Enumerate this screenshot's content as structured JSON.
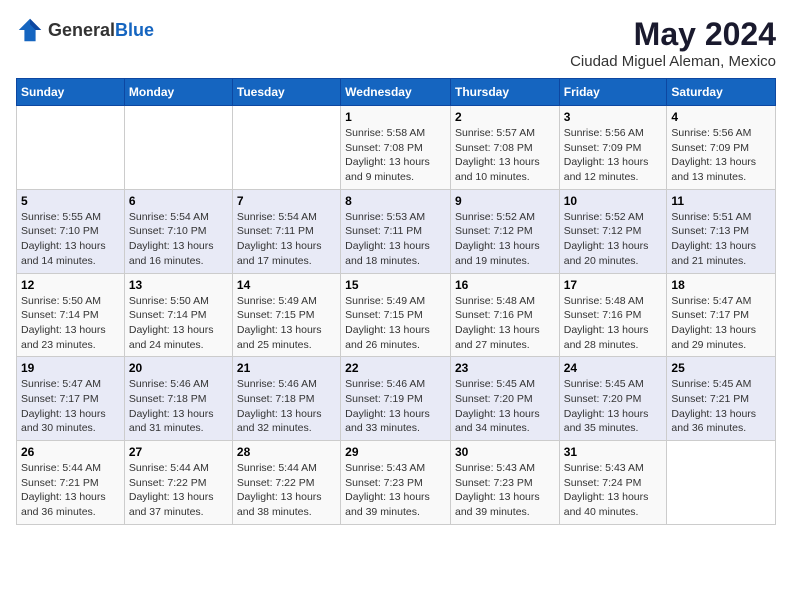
{
  "header": {
    "logo_general": "General",
    "logo_blue": "Blue",
    "main_title": "May 2024",
    "subtitle": "Ciudad Miguel Aleman, Mexico"
  },
  "days_of_week": [
    "Sunday",
    "Monday",
    "Tuesday",
    "Wednesday",
    "Thursday",
    "Friday",
    "Saturday"
  ],
  "weeks": [
    {
      "days": [
        {
          "num": "",
          "info": ""
        },
        {
          "num": "",
          "info": ""
        },
        {
          "num": "",
          "info": ""
        },
        {
          "num": "1",
          "info": "Sunrise: 5:58 AM\nSunset: 7:08 PM\nDaylight: 13 hours\nand 9 minutes."
        },
        {
          "num": "2",
          "info": "Sunrise: 5:57 AM\nSunset: 7:08 PM\nDaylight: 13 hours\nand 10 minutes."
        },
        {
          "num": "3",
          "info": "Sunrise: 5:56 AM\nSunset: 7:09 PM\nDaylight: 13 hours\nand 12 minutes."
        },
        {
          "num": "4",
          "info": "Sunrise: 5:56 AM\nSunset: 7:09 PM\nDaylight: 13 hours\nand 13 minutes."
        }
      ]
    },
    {
      "days": [
        {
          "num": "5",
          "info": "Sunrise: 5:55 AM\nSunset: 7:10 PM\nDaylight: 13 hours\nand 14 minutes."
        },
        {
          "num": "6",
          "info": "Sunrise: 5:54 AM\nSunset: 7:10 PM\nDaylight: 13 hours\nand 16 minutes."
        },
        {
          "num": "7",
          "info": "Sunrise: 5:54 AM\nSunset: 7:11 PM\nDaylight: 13 hours\nand 17 minutes."
        },
        {
          "num": "8",
          "info": "Sunrise: 5:53 AM\nSunset: 7:11 PM\nDaylight: 13 hours\nand 18 minutes."
        },
        {
          "num": "9",
          "info": "Sunrise: 5:52 AM\nSunset: 7:12 PM\nDaylight: 13 hours\nand 19 minutes."
        },
        {
          "num": "10",
          "info": "Sunrise: 5:52 AM\nSunset: 7:12 PM\nDaylight: 13 hours\nand 20 minutes."
        },
        {
          "num": "11",
          "info": "Sunrise: 5:51 AM\nSunset: 7:13 PM\nDaylight: 13 hours\nand 21 minutes."
        }
      ]
    },
    {
      "days": [
        {
          "num": "12",
          "info": "Sunrise: 5:50 AM\nSunset: 7:14 PM\nDaylight: 13 hours\nand 23 minutes."
        },
        {
          "num": "13",
          "info": "Sunrise: 5:50 AM\nSunset: 7:14 PM\nDaylight: 13 hours\nand 24 minutes."
        },
        {
          "num": "14",
          "info": "Sunrise: 5:49 AM\nSunset: 7:15 PM\nDaylight: 13 hours\nand 25 minutes."
        },
        {
          "num": "15",
          "info": "Sunrise: 5:49 AM\nSunset: 7:15 PM\nDaylight: 13 hours\nand 26 minutes."
        },
        {
          "num": "16",
          "info": "Sunrise: 5:48 AM\nSunset: 7:16 PM\nDaylight: 13 hours\nand 27 minutes."
        },
        {
          "num": "17",
          "info": "Sunrise: 5:48 AM\nSunset: 7:16 PM\nDaylight: 13 hours\nand 28 minutes."
        },
        {
          "num": "18",
          "info": "Sunrise: 5:47 AM\nSunset: 7:17 PM\nDaylight: 13 hours\nand 29 minutes."
        }
      ]
    },
    {
      "days": [
        {
          "num": "19",
          "info": "Sunrise: 5:47 AM\nSunset: 7:17 PM\nDaylight: 13 hours\nand 30 minutes."
        },
        {
          "num": "20",
          "info": "Sunrise: 5:46 AM\nSunset: 7:18 PM\nDaylight: 13 hours\nand 31 minutes."
        },
        {
          "num": "21",
          "info": "Sunrise: 5:46 AM\nSunset: 7:18 PM\nDaylight: 13 hours\nand 32 minutes."
        },
        {
          "num": "22",
          "info": "Sunrise: 5:46 AM\nSunset: 7:19 PM\nDaylight: 13 hours\nand 33 minutes."
        },
        {
          "num": "23",
          "info": "Sunrise: 5:45 AM\nSunset: 7:20 PM\nDaylight: 13 hours\nand 34 minutes."
        },
        {
          "num": "24",
          "info": "Sunrise: 5:45 AM\nSunset: 7:20 PM\nDaylight: 13 hours\nand 35 minutes."
        },
        {
          "num": "25",
          "info": "Sunrise: 5:45 AM\nSunset: 7:21 PM\nDaylight: 13 hours\nand 36 minutes."
        }
      ]
    },
    {
      "days": [
        {
          "num": "26",
          "info": "Sunrise: 5:44 AM\nSunset: 7:21 PM\nDaylight: 13 hours\nand 36 minutes."
        },
        {
          "num": "27",
          "info": "Sunrise: 5:44 AM\nSunset: 7:22 PM\nDaylight: 13 hours\nand 37 minutes."
        },
        {
          "num": "28",
          "info": "Sunrise: 5:44 AM\nSunset: 7:22 PM\nDaylight: 13 hours\nand 38 minutes."
        },
        {
          "num": "29",
          "info": "Sunrise: 5:43 AM\nSunset: 7:23 PM\nDaylight: 13 hours\nand 39 minutes."
        },
        {
          "num": "30",
          "info": "Sunrise: 5:43 AM\nSunset: 7:23 PM\nDaylight: 13 hours\nand 39 minutes."
        },
        {
          "num": "31",
          "info": "Sunrise: 5:43 AM\nSunset: 7:24 PM\nDaylight: 13 hours\nand 40 minutes."
        },
        {
          "num": "",
          "info": ""
        }
      ]
    }
  ]
}
